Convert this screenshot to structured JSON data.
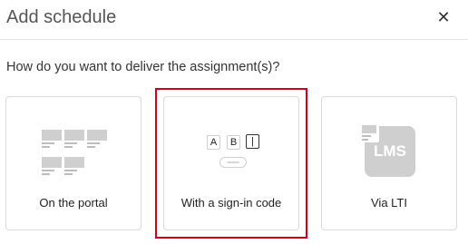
{
  "dialog": {
    "title": "Add schedule",
    "close_icon": "close-icon",
    "question": "How do you want to deliver the assignment(s)?"
  },
  "options": [
    {
      "label": "On the portal",
      "icon": "portal-icon"
    },
    {
      "label": "With a sign-in code",
      "icon": "sign-in-code-icon",
      "highlighted": true,
      "keys": [
        "A",
        "B",
        "|"
      ]
    },
    {
      "label": "Via LTI",
      "icon": "lms-icon",
      "icon_text": "LMS"
    }
  ],
  "colors": {
    "highlight": "#d0021b",
    "card_border": "#d9d9d9",
    "icon_gray": "#cfcfcf"
  }
}
